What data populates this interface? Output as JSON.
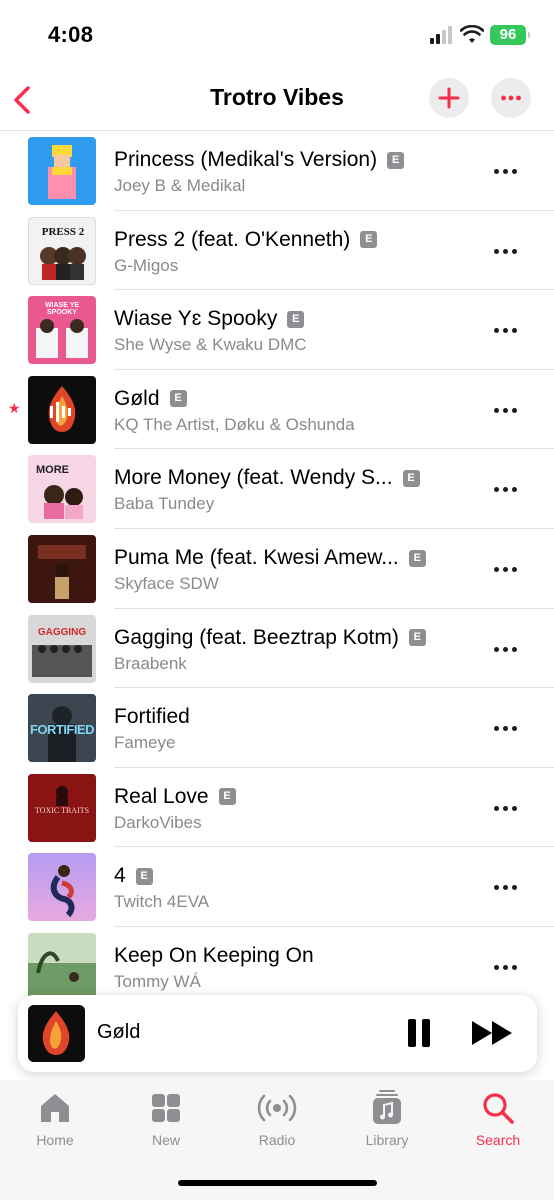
{
  "status_bar": {
    "time": "4:08",
    "battery": "96"
  },
  "nav": {
    "title": "Trotro Vibes"
  },
  "tracks": [
    {
      "title": "Princess (Medikal's Version)",
      "artist": "Joey B & Medikal",
      "explicit": true
    },
    {
      "title": "Press 2 (feat. O'Kenneth)",
      "artist": "G-Migos",
      "explicit": true,
      "art_text": "PRESS 2"
    },
    {
      "title": "Wiase Yɛ Spooky",
      "artist": "She Wyse & Kwaku DMC",
      "explicit": true,
      "art_text": "WIASE YE SPOOKY"
    },
    {
      "title": "Gøld",
      "artist": "KQ The Artist, Døku & Oshunda",
      "explicit": true,
      "favorite": true
    },
    {
      "title": "More Money (feat. Wendy S...",
      "artist": "Baba Tundey",
      "explicit": true
    },
    {
      "title": "Puma Me (feat. Kwesi Amew...",
      "artist": "Skyface SDW",
      "explicit": true
    },
    {
      "title": "Gagging (feat. Beeztrap Kotm)",
      "artist": "Braabenk",
      "explicit": true,
      "art_text": "GAGGING"
    },
    {
      "title": "Fortified",
      "artist": "Fameye",
      "explicit": false,
      "art_text": "FORTIFIED"
    },
    {
      "title": "Real Love",
      "artist": "DarkoVibes",
      "explicit": true,
      "art_text": "TOXIC TRAITS"
    },
    {
      "title": "4",
      "artist": "Twitch 4EVA",
      "explicit": true
    },
    {
      "title": "Keep On Keeping On",
      "artist": "Tommy WÁ",
      "explicit": false
    }
  ],
  "explicit_badge": "E",
  "mini_player": {
    "title": "Gøld"
  },
  "tabs": [
    {
      "label": "Home",
      "icon": "home-icon"
    },
    {
      "label": "New",
      "icon": "grid-icon"
    },
    {
      "label": "Radio",
      "icon": "radio-icon"
    },
    {
      "label": "Library",
      "icon": "library-icon"
    },
    {
      "label": "Search",
      "icon": "search-icon",
      "active": true
    }
  ],
  "colors": {
    "accent": "#fa2d48",
    "battery": "#34c759",
    "secondary_text": "#8a8a8e"
  }
}
